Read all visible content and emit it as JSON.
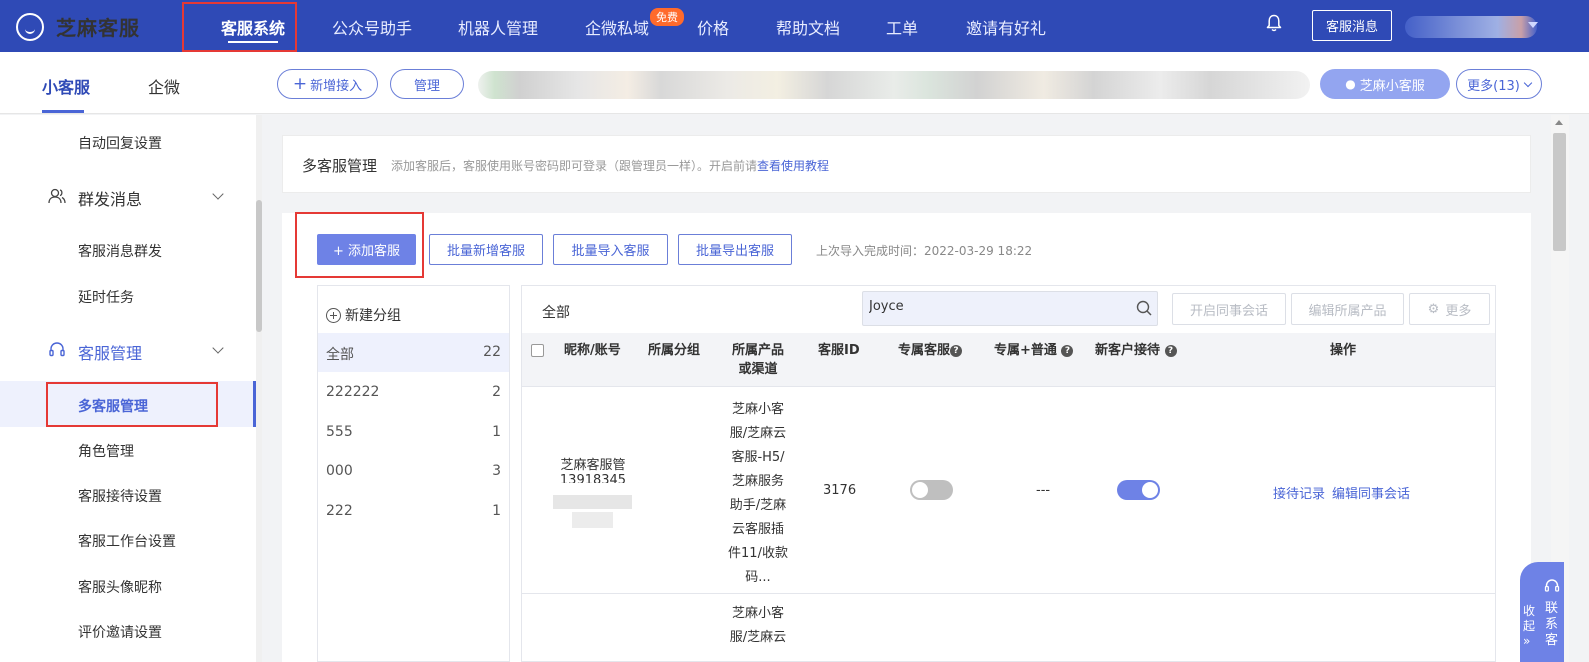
{
  "brand": {
    "name": "芝麻客服"
  },
  "topnav": {
    "items": [
      "客服系统",
      "公众号助手",
      "机器人管理",
      "企微私域",
      "价格",
      "帮助文档",
      "工单",
      "邀请有好礼"
    ],
    "free_badge": "免费",
    "msg_button": "客服消息"
  },
  "subbar": {
    "tabs": [
      "小客服",
      "企微"
    ],
    "add_access": "新增接入",
    "manage": "管理",
    "zhima_button": "芝麻小客服",
    "more_button": "更多(13)"
  },
  "sidebar": {
    "items": [
      {
        "label": "自动回复设置",
        "type": "item"
      },
      {
        "label": "群发消息",
        "type": "group"
      },
      {
        "label": "客服消息群发",
        "type": "item"
      },
      {
        "label": "延时任务",
        "type": "item"
      },
      {
        "label": "客服管理",
        "type": "group"
      },
      {
        "label": "多客服管理",
        "type": "item"
      },
      {
        "label": "角色管理",
        "type": "item"
      },
      {
        "label": "客服接待设置",
        "type": "item"
      },
      {
        "label": "客服工作台设置",
        "type": "item"
      },
      {
        "label": "客服头像昵称",
        "type": "item"
      },
      {
        "label": "评价邀请设置",
        "type": "item"
      }
    ]
  },
  "intro": {
    "title": "多客服管理",
    "desc": "添加客服后，客服使用账号密码即可登录（跟管理员一样）。开启前请",
    "link": "查看使用教程"
  },
  "toolbar": {
    "add": "+ 添加客服",
    "batch_add": "批量新增客服",
    "batch_import": "批量导入客服",
    "batch_export": "批量导出客服",
    "last_import": "上次导入完成时间：2022-03-29 18:22"
  },
  "groups": {
    "new_group": "新建分组",
    "list": [
      {
        "name": "全部",
        "count": "22"
      },
      {
        "name": "222222",
        "count": "2"
      },
      {
        "name": "555",
        "count": "1"
      },
      {
        "name": "000",
        "count": "3"
      },
      {
        "name": "222",
        "count": "1"
      }
    ]
  },
  "table": {
    "filter_label": "全部",
    "search_value": "Joyce",
    "actions": [
      "开启同事会话",
      "编辑所属产品",
      "更多"
    ],
    "columns": [
      "昵称/账号",
      "所属分组",
      "所属产品或渠道",
      "客服ID",
      "专属客服",
      "专属+普通",
      "新客户接待",
      "操作"
    ],
    "rows": [
      {
        "nickname": "芝麻客服管",
        "account": "13918345",
        "group": "",
        "products": [
          "芝麻小客",
          "服/芝麻云",
          "客服-H5/",
          "芝麻服务",
          "助手/芝麻",
          "云客服插",
          "件11/收款",
          "码..."
        ],
        "service_id": "3176",
        "exclusive": false,
        "exclusive_normal": "---",
        "new_customer": true,
        "ops": [
          "接待记录",
          "编辑同事会话"
        ]
      },
      {
        "products_partial": [
          "芝麻小客",
          "服/芝麻云"
        ]
      }
    ]
  },
  "float": {
    "collapse": "收起",
    "arrows": "»",
    "contact": "联系客"
  },
  "colors": {
    "nav_bg": "#2f4ab6",
    "accent": "#4a65d6",
    "primary_btn": "#6e82e6",
    "highlight_box": "#e53935"
  }
}
